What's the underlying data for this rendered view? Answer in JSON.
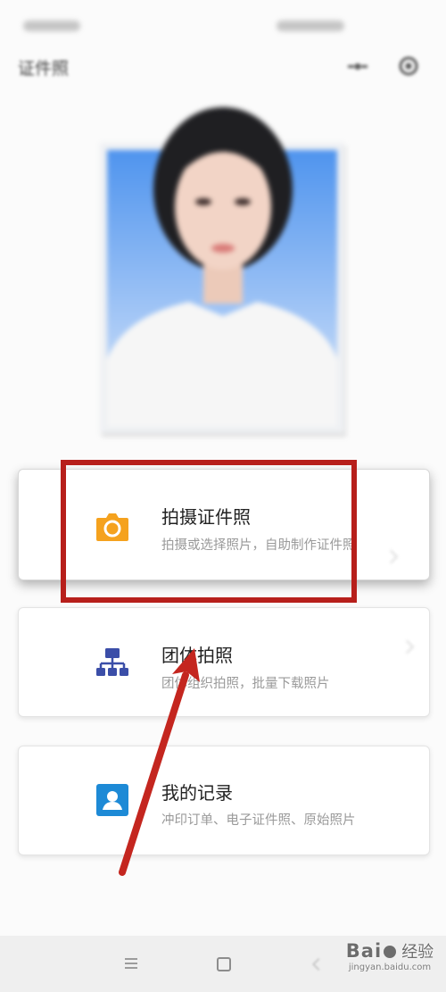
{
  "app": {
    "title": "证件照"
  },
  "header": {
    "icons": [
      "more-dots-icon",
      "close-circle-icon"
    ]
  },
  "menu": [
    {
      "icon": "camera-icon",
      "title": "拍摄证件照",
      "subtitle": "拍摄或选择照片，自助制作证件照",
      "color": "#f5a21e"
    },
    {
      "icon": "org-chart-icon",
      "title": "团体拍照",
      "subtitle": "团体组织拍照，批量下载照片",
      "color": "#3b4ea8"
    },
    {
      "icon": "contact-card-icon",
      "title": "我的记录",
      "subtitle": "冲印订单、电子证件照、原始照片",
      "color": "#1d8ad6"
    }
  ],
  "annotation": {
    "highlight_color": "#b71f1b",
    "arrow_color": "#c4261f"
  },
  "navbar": {
    "icons": [
      "menu-icon",
      "home-square-icon",
      "back-icon"
    ]
  },
  "watermark": {
    "brand": "Bai",
    "brand2": "经验",
    "url": "jingyan.baidu.com"
  }
}
